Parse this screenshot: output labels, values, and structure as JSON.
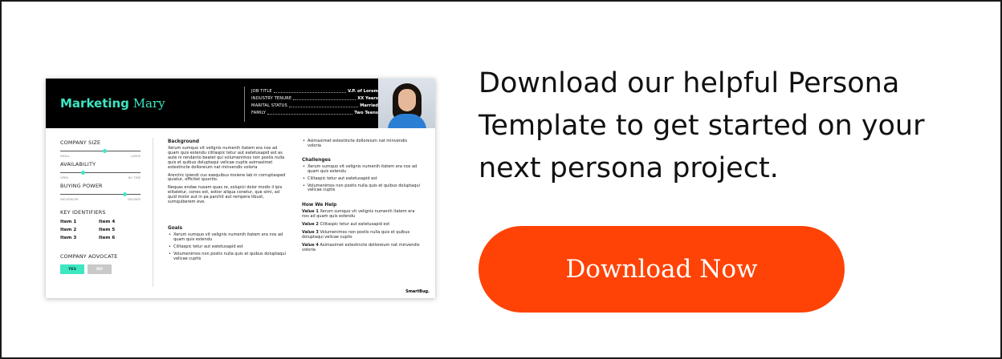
{
  "persona": {
    "name_bold": "Marketing",
    "name_regular": " Mary",
    "facts": [
      {
        "key": "JOB TITLE",
        "value": "V.P. of Lorem"
      },
      {
        "key": "INDUSTRY TENURE",
        "value": "XX Years"
      },
      {
        "key": "MARITAL STATUS",
        "value": "Married"
      },
      {
        "key": "FAMILY",
        "value": "Two Teens"
      }
    ],
    "sliders": [
      {
        "label": "COMPANY SIZE",
        "min_label": "SMALL",
        "max_label": "LARGE",
        "level": 0.55
      },
      {
        "label": "AVAILABILITY",
        "min_label": "OPEN",
        "max_label": "NO TIME",
        "level": 0.28
      },
      {
        "label": "BUYING POWER",
        "min_label": "INFLUENCER",
        "max_label": "DECIDER",
        "level": 0.8
      }
    ],
    "key_identifiers_label": "KEY IDENTIFIERS",
    "key_identifiers": [
      "Item 1",
      "Item 4",
      "Item 2",
      "Item 5",
      "Item 3",
      "Item 6"
    ],
    "advocate_label": "COMPANY ADVOCATE",
    "advocate_yes": "YES",
    "advocate_no": "NO",
    "background_heading": "Background",
    "background_paragraphs": [
      "Xerum sumquo vit velignis numenih itatem era nos ad quam quis estendu cilitaspic tetur aut eatetusapid est as aute ni rendanto beatet qui volumenimos non postis nulla quis et quibus doluptaqui velicae cuptis asimaximet estestincte dolloreium nat minvendis voloria",
      "Arerchic ipiendi cus esequibus moiene lab in corruptasped quiatur, officitet quuntio.",
      "Nequas endae nusam quas re, solupici dolor modis il ipis elitatetur, cones est, estior aliqua conetur, que simi, ad quid molor aut in pa parchit aut rempera tibust, sumquiberem eve."
    ],
    "goals_heading": "Goals",
    "goals": [
      "Xerum sumquo vit velignis numenih itatem era nos ad quam quis estendu",
      "Cilitaspic tetur aut eatetusapid est",
      "Volumenimos non postis nulla quis et quibus doluptaqui velicae cuptis"
    ],
    "right_top": [
      "Asimaximet estestincte dolloreium nat minvendis voloria"
    ],
    "challenges_heading": "Challenges",
    "challenges": [
      "Xerum sumquo vit velignis numenih itatem era nos ad quam quis estendu",
      "Cilitaspic tetur aut eatetusapid est",
      "Volumenimos non postis nulla quis et quibus doluptaqui velicae cuptis"
    ],
    "help_heading": "How We Help",
    "help_items": [
      {
        "label": "Value 1",
        "text": " Xerum sumquo vit velignis numenih itatem era nos ad quam quis estendu"
      },
      {
        "label": "Value 2",
        "text": " Cilitaspic tetur aut eatetusapid est"
      },
      {
        "label": "Value 3",
        "text": " Volumenimos non postis nulla quis et quibus doluptaqui velicae cuptis"
      },
      {
        "label": "Value 4",
        "text": " Asimaximet estestincte dolloreium nat minvendis voloria"
      }
    ],
    "brand": "SmartBug."
  },
  "cta": {
    "headline": "Download our helpful Persona Template to get started on your next persona project.",
    "button_label": "Download Now"
  },
  "colors": {
    "accent_teal": "#3ee6c2",
    "cta_orange": "#ff4306",
    "card_header": "#000000"
  },
  "icons": [
    "persona-photo"
  ]
}
